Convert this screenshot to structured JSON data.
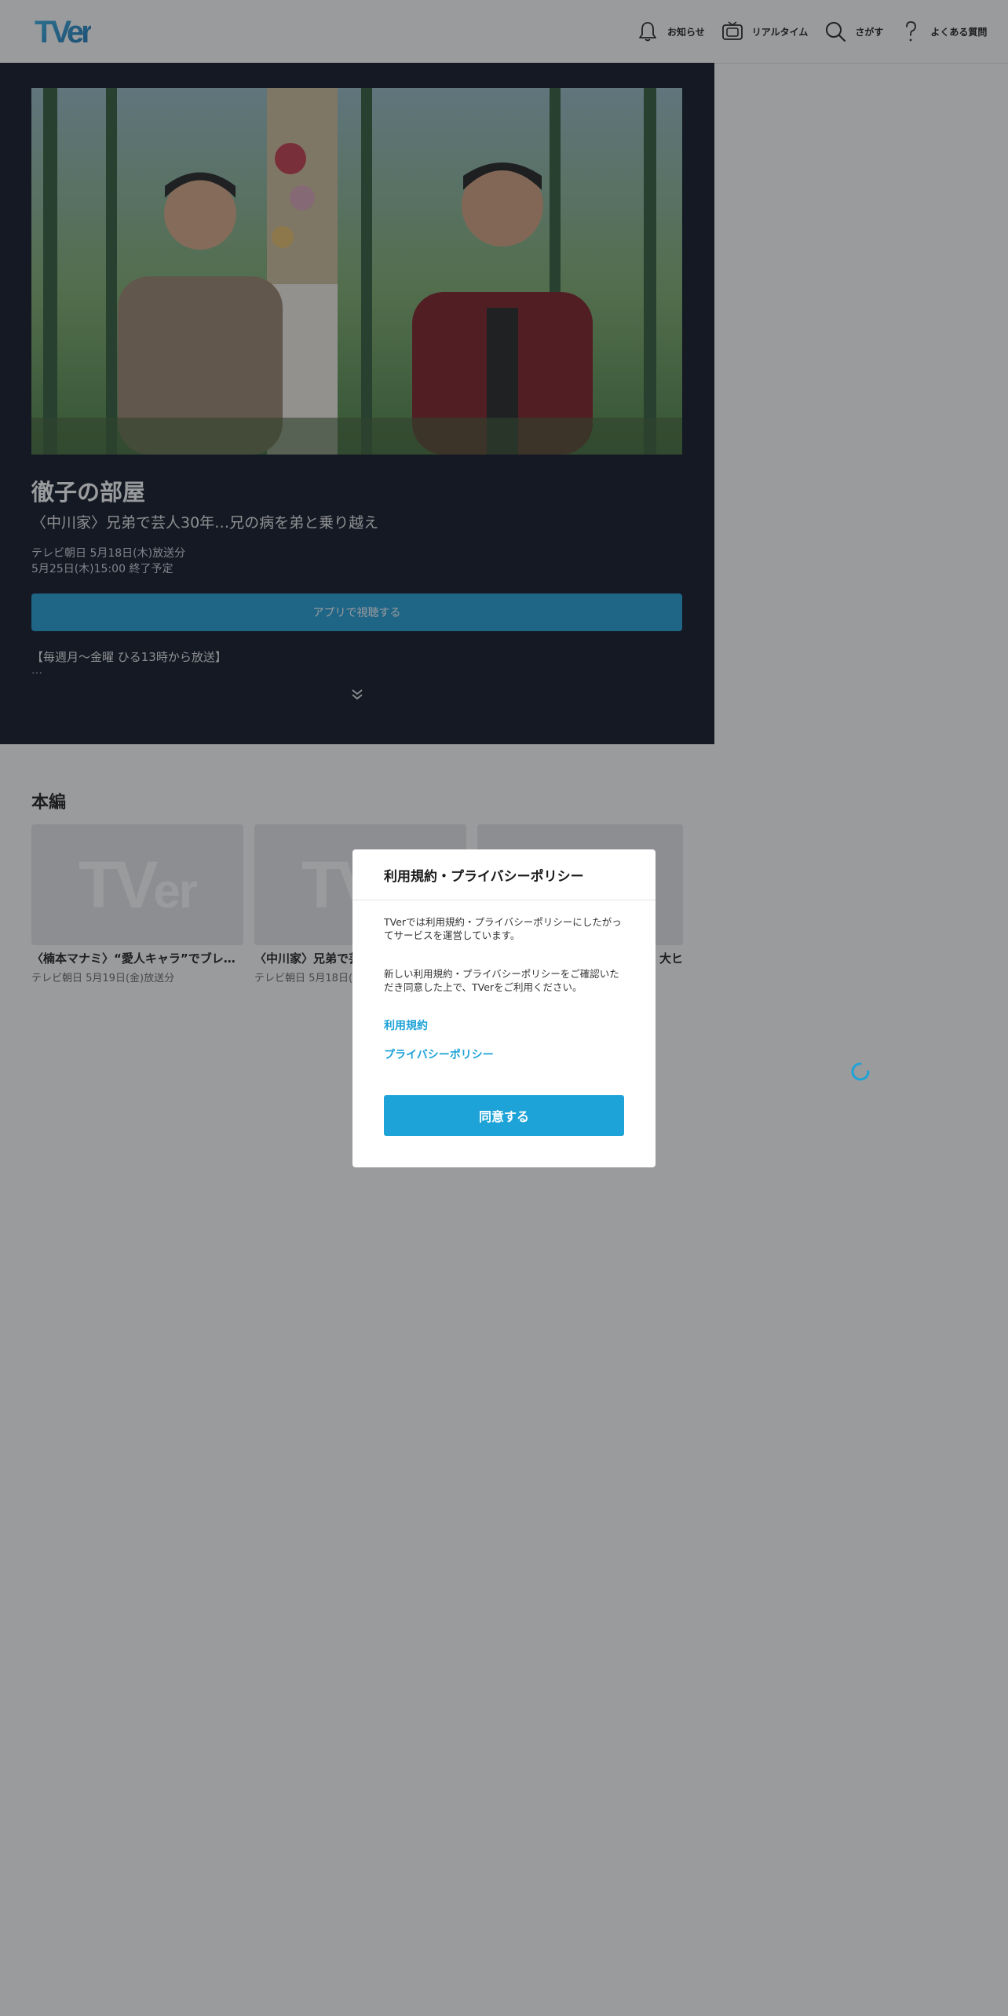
{
  "header": {
    "logo_text": "TVer",
    "nav": [
      {
        "label": "お知らせ",
        "icon": "bell-icon"
      },
      {
        "label": "リアルタイム",
        "icon": "tv-icon"
      },
      {
        "label": "さがす",
        "icon": "search-icon"
      },
      {
        "label": "よくある質問",
        "icon": "question-icon"
      }
    ]
  },
  "hero": {
    "title": "徹子の部屋",
    "subtitle": "〈中川家〉兄弟で芸人30年…兄の病を弟と乗り越え",
    "broadcast": "テレビ朝日 5月18日(木)放送分",
    "expiry": "5月25日(木)15:00 終了予定",
    "watch_button": "アプリで視聴する",
    "description": "【毎週月～金曜 ひる13時から放送】",
    "ellipsis": "…"
  },
  "episodes": {
    "section_title": "本編",
    "items": [
      {
        "title": "〈楠本マナミ〉“愛人キャラ”でブレ…",
        "meta": "テレビ朝日 5月19日(金)放送分"
      },
      {
        "title": "〈中川家〉兄弟で芸",
        "meta": "テレビ朝日 5月18日(木"
      },
      {
        "title": "大ヒ",
        "meta": ""
      }
    ]
  },
  "modal": {
    "title": "利用規約・プライバシーポリシー",
    "paragraph1": "TVerでは利用規約・プライバシーポリシーにしたがってサービスを運営しています。",
    "paragraph2": "新しい利用規約・プライバシーポリシーをご確認いただき同意した上で、TVerをご利用ください。",
    "link_terms": "利用規約",
    "link_privacy": "プライバシーポリシー",
    "agree_button": "同意する"
  },
  "colors": {
    "accent": "#1ea3d8",
    "hero_bg": "#0b1323",
    "overlay": "rgba(30,33,38,0.45)"
  }
}
